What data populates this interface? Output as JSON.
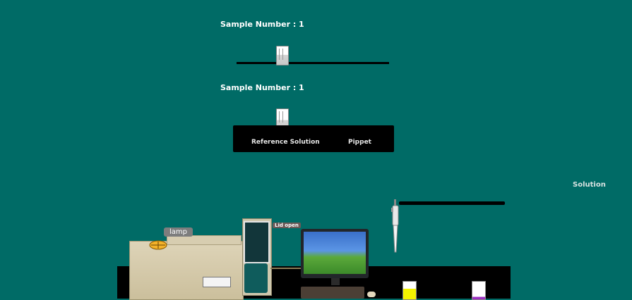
{
  "top_panel": {
    "sample_label": "Sample Number : 1"
  },
  "middle_panel": {
    "sample_label": "Sample Number : 1",
    "reference_label": "Reference Solution",
    "pippet_label": "Pippet"
  },
  "right_panel": {
    "solution_label": "Solution"
  },
  "bench": {
    "lamp_label": "lamp",
    "lid_label": "Lid open"
  },
  "colors": {
    "background": "#006b66",
    "tube_yellow": "#f2f200",
    "tube_purple": "#9b2fc1"
  }
}
